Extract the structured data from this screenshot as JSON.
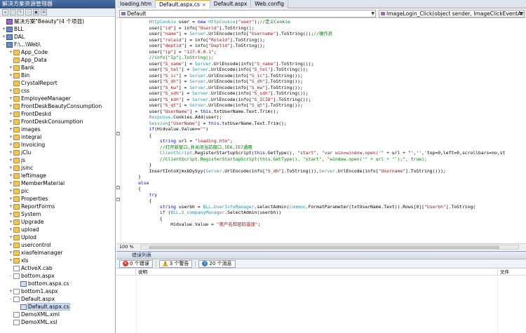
{
  "solution_explorer": {
    "title": "解决方案资源管理器",
    "items": [
      {
        "label": "解决方案\"Beauty\"(4 个项目)",
        "level": 0,
        "icon": "sln",
        "expander": ""
      },
      {
        "label": "BLL",
        "level": 0,
        "icon": "proj",
        "expander": "+"
      },
      {
        "label": "DAL",
        "level": 0,
        "icon": "proj",
        "expander": "+"
      },
      {
        "label": "F:\\...\\Web\\",
        "level": 0,
        "icon": "proj",
        "expander": "-"
      },
      {
        "label": "App_Code",
        "level": 1,
        "icon": "folder",
        "expander": "+"
      },
      {
        "label": "App_Data",
        "level": 1,
        "icon": "folder",
        "expander": ""
      },
      {
        "label": "Bank",
        "level": 1,
        "icon": "folder",
        "expander": "+"
      },
      {
        "label": "Bin",
        "level": 1,
        "icon": "folder",
        "expander": "+"
      },
      {
        "label": "CrystalReport",
        "level": 1,
        "icon": "folder",
        "expander": ""
      },
      {
        "label": "css",
        "level": 1,
        "icon": "folder",
        "expander": "+"
      },
      {
        "label": "EmployeeManager",
        "level": 1,
        "icon": "folder",
        "expander": "+"
      },
      {
        "label": "FrontDeskBeautyConsumption",
        "level": 1,
        "icon": "folder",
        "expander": "+"
      },
      {
        "label": "FrontDeskd",
        "level": 1,
        "icon": "folder",
        "expander": "+"
      },
      {
        "label": "FrontDeskConsumption",
        "level": 1,
        "icon": "folder",
        "expander": "+"
      },
      {
        "label": "images",
        "level": 1,
        "icon": "folder",
        "expander": "+"
      },
      {
        "label": "integral",
        "level": 1,
        "icon": "folder",
        "expander": "+"
      },
      {
        "label": "Invoicing",
        "level": 1,
        "icon": "folder",
        "expander": "+"
      },
      {
        "label": "jClu",
        "level": 1,
        "icon": "folder",
        "expander": "+"
      },
      {
        "label": "js",
        "level": 1,
        "icon": "folder",
        "expander": "+"
      },
      {
        "label": "jsinc",
        "level": 1,
        "icon": "folder",
        "expander": "+"
      },
      {
        "label": "leftimage",
        "level": 1,
        "icon": "folder",
        "expander": "+"
      },
      {
        "label": "MemberMaterial",
        "level": 1,
        "icon": "folder",
        "expander": "+"
      },
      {
        "label": "pic",
        "level": 1,
        "icon": "folder",
        "expander": "+"
      },
      {
        "label": "Properties",
        "level": 1,
        "icon": "folder",
        "expander": "+"
      },
      {
        "label": "ReportForms",
        "level": 1,
        "icon": "folder",
        "expander": "+"
      },
      {
        "label": "System",
        "level": 1,
        "icon": "folder",
        "expander": "+"
      },
      {
        "label": "Upgrade",
        "level": 1,
        "icon": "folder",
        "expander": "+"
      },
      {
        "label": "upload",
        "level": 1,
        "icon": "folder",
        "expander": "+"
      },
      {
        "label": "Uplod",
        "level": 1,
        "icon": "folder",
        "expander": "+"
      },
      {
        "label": "usercontrol",
        "level": 1,
        "icon": "folder",
        "expander": "+"
      },
      {
        "label": "xiaofeimanager",
        "level": 1,
        "icon": "folder",
        "expander": "+"
      },
      {
        "label": "xls",
        "level": 1,
        "icon": "folder",
        "expander": "+"
      },
      {
        "label": "ActiveX.cab",
        "level": 1,
        "icon": "file",
        "expander": ""
      },
      {
        "label": "bottom.aspx",
        "level": 1,
        "icon": "file",
        "expander": "-"
      },
      {
        "label": "bottom.aspx.cs",
        "level": 2,
        "icon": "filecs",
        "expander": ""
      },
      {
        "label": "bottom1.aspx",
        "level": 1,
        "icon": "file",
        "expander": "+"
      },
      {
        "label": "Default.aspx",
        "level": 1,
        "icon": "file",
        "expander": "-"
      },
      {
        "label": "Default.aspx.cs",
        "level": 2,
        "icon": "filecs",
        "expander": "",
        "selected": true
      },
      {
        "label": "DemoXML.xml",
        "level": 1,
        "icon": "file",
        "expander": ""
      },
      {
        "label": "DemoXML.xsl",
        "level": 1,
        "icon": "file",
        "expander": ""
      }
    ]
  },
  "tabs": [
    {
      "label": "loading.htm",
      "active": false,
      "closable": false
    },
    {
      "label": "Default.aspx.cs",
      "active": true,
      "closable": true
    },
    {
      "label": "Default.aspx",
      "active": false,
      "closable": false
    },
    {
      "label": "Web.config",
      "active": false,
      "closable": false
    }
  ],
  "navbar": {
    "class_selector": "Default",
    "member_selector": "ImageLogin_Click(object sender, ImageClickEventArgs e)"
  },
  "code_lines": [
    {
      "indent": 10,
      "text": "HttpCookie user = new HttpCookie(\"user\");//定义Cookie"
    },
    {
      "indent": 10,
      "text": "user[\"id\"] = info[\"Userid\"].ToString();"
    },
    {
      "indent": 10,
      "text": "user[\"name\"] = Server.UrlEncode(info[\"Username\"].ToString());//操作员"
    },
    {
      "indent": 10,
      "text": "user[\"roleid\"] = info[\"Roleid\"].ToString();"
    },
    {
      "indent": 10,
      "text": "user[\"deptid\"] = info[\"Deptid\"].ToString();"
    },
    {
      "indent": 10,
      "text": "user[\"ip\"] = \"127.0.0.1\";"
    },
    {
      "indent": 10,
      "text": "//info[\"Ip\"].ToString();"
    },
    {
      "indent": 10,
      "text": "user[\"S_name\"] = Server.UrlEncode(info[\"S_name\"].ToString());"
    },
    {
      "indent": 10,
      "text": "user[\"S_tel\"] = Server.UrlEncode(info[\"S_tel\"].ToString());"
    },
    {
      "indent": 10,
      "text": "user[\"S_ic\"] = Server.UrlEncode(info[\"S_ic\"].ToString());"
    },
    {
      "indent": 10,
      "text": "user[\"S_dh\"] = Server.UrlEncode(info[\"S_dh\"].ToString());"
    },
    {
      "indent": 10,
      "text": "user[\"S_kw\"] = Server.UrlEncode(info[\"S_kw\"].ToString());"
    },
    {
      "indent": 10,
      "text": "user[\"S_sdh\"] = Server.UrlEncode(info[\"S_sdh\"].ToString());"
    },
    {
      "indent": 10,
      "text": "user[\"S_kdh\"] = Server.UrlEncode(info[\"S_ICID\"].ToString());"
    },
    {
      "indent": 10,
      "text": "user[\"S_qt\"] = Server.UrlEncode(info[\"S_qt\"].ToString());"
    },
    {
      "indent": 10,
      "text": "user[\"UserName\"] = this.txtUserName.Text.Trim();"
    },
    {
      "indent": 10,
      "text": "Response.Cookies.Add(user);"
    },
    {
      "indent": 10,
      "text": "Session[\"UserName\"] = this.txtUserName.Text.Trim();"
    },
    {
      "indent": 10,
      "text": "if(Hidvalue.Value==\"\")"
    },
    {
      "indent": 10,
      "text": "{"
    },
    {
      "indent": 14,
      "text": "string url = \"loading.htm\";"
    },
    {
      "indent": 14,
      "text": "//打开新窗口,并关闭当前窗口,IE6,IE7通用"
    },
    {
      "indent": 14,
      "text": "ClientScript.RegisterStartupScript(this.GetType(), \"start\", \"var win=window.open('\" + url + \"','','top=0,left=0,scrollbars=no,st"
    },
    {
      "indent": 14,
      "text": "//ClientScript.RegisterStartupScript(this.GetType(), \"start\", \"window.open('\" + url + \"');\", true);"
    },
    {
      "indent": 10,
      "text": "}"
    },
    {
      "indent": 10,
      "text": "InsertIntoXjmxbDySyy(Server.UrlEncode(info[\"S_dh\"].ToString()),Server.UrlEncode(info[\"Username\"].ToString()));"
    },
    {
      "indent": 6,
      "text": "}"
    },
    {
      "indent": 6,
      "text": "else"
    },
    {
      "indent": 6,
      "text": "{"
    },
    {
      "indent": 10,
      "text": "try"
    },
    {
      "indent": 10,
      "text": "{"
    },
    {
      "indent": 14,
      "text": "string userbh = BLL.UserInfoManager.selectAdmin(Common.FormatParameter(txtUserName.Text)).Rows[0][\"Userbh\"].ToString("
    },
    {
      "indent": 14,
      "text": "if (BLL.S_companyManager.SelectAdmin(userbh))"
    },
    {
      "indent": 14,
      "text": "{"
    },
    {
      "indent": 18,
      "text": "Hidvalue.Value = \"用户名和密码错误\";"
    }
  ],
  "zoom": "100 %",
  "hscroll": {
    "thumb_start": 0.02,
    "thumb_size": 0.93
  },
  "error_list": {
    "title": "错误列表",
    "errors_label": "0 个错误",
    "warnings_label": "3 个警告",
    "messages_label": "20 个消息",
    "columns": {
      "description": "说明",
      "file": "文件"
    }
  },
  "colors": {
    "keyword": "#0000ff",
    "type": "#2b91af",
    "string": "#a31515",
    "comment": "#008000"
  }
}
